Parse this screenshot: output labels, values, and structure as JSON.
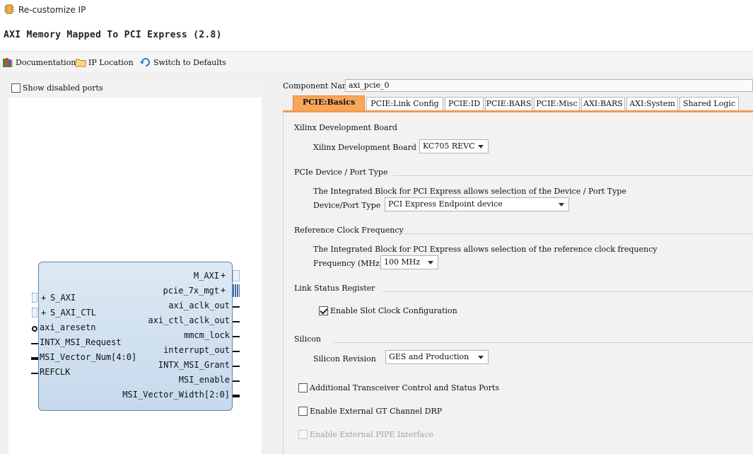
{
  "window": {
    "title": "Re-customize IP"
  },
  "heading": "AXI Memory Mapped To PCI Express (2.8)",
  "toolbar": {
    "documentation": "Documentation",
    "ip_location": "IP Location",
    "switch_defaults": "Switch to Defaults"
  },
  "left": {
    "show_disabled_ports": "Show disabled ports",
    "show_disabled_checked": false,
    "block": {
      "left_ports": [
        "S_AXI",
        "S_AXI_CTL",
        "axi_aresetn",
        "INTX_MSI_Request",
        "MSI_Vector_Num[4:0]",
        "REFCLK"
      ],
      "right_ports": [
        "M_AXI",
        "pcie_7x_mgt",
        "axi_aclk_out",
        "axi_ctl_aclk_out",
        "mmcm_lock",
        "interrupt_out",
        "INTX_MSI_Grant",
        "MSI_enable",
        "MSI_Vector_Width[2:0]"
      ]
    }
  },
  "right": {
    "component_name_label": "Component Name",
    "component_name_value": "axi_pcie_0",
    "tabs": [
      "PCIE:Basics",
      "PCIE:Link Config",
      "PCIE:ID",
      "PCIE:BARS",
      "PCIE:Misc",
      "AXI:BARS",
      "AXI:System",
      "Shared Logic"
    ],
    "active_tab": "PCIE:Basics",
    "sections": {
      "board": {
        "title": "Xilinx Development Board",
        "label": "Xilinx Development Board",
        "value": "KC705 REVC"
      },
      "device_port": {
        "title": "PCIe Device / Port Type",
        "desc": "The Integrated Block for PCI Express allows selection of the Device / Port Type",
        "label": "Device/Port Type",
        "value": "PCI Express Endpoint device"
      },
      "refclk": {
        "title": "Reference Clock Frequency",
        "desc": "The Integrated Block for PCI Express allows selection of the reference clock frequency",
        "label": "Frequency (MHz)",
        "value": "100 MHz"
      },
      "link_status": {
        "title": "Link Status Register",
        "checkbox_label": "Enable Slot Clock Configuration",
        "checked": true
      },
      "silicon": {
        "title": "Silicon",
        "label": "Silicon Revision",
        "value": "GES and Production"
      },
      "options": {
        "additional_transceiver": "Additional Transceiver Control and Status Ports",
        "external_gt_drp": "Enable External GT Channel DRP",
        "external_pipe": "Enable External PIPE Interface"
      }
    }
  },
  "colors": {
    "active_tab": "#f8a65a",
    "tab_border_accent": "#f59a4a",
    "block_fill": "#c6d9ec",
    "block_border": "#5f87b0"
  },
  "icons": {
    "app": "ip-chip-icon",
    "documentation": "books-icon",
    "ip_location": "folder-icon",
    "switch_defaults": "refresh-icon"
  }
}
